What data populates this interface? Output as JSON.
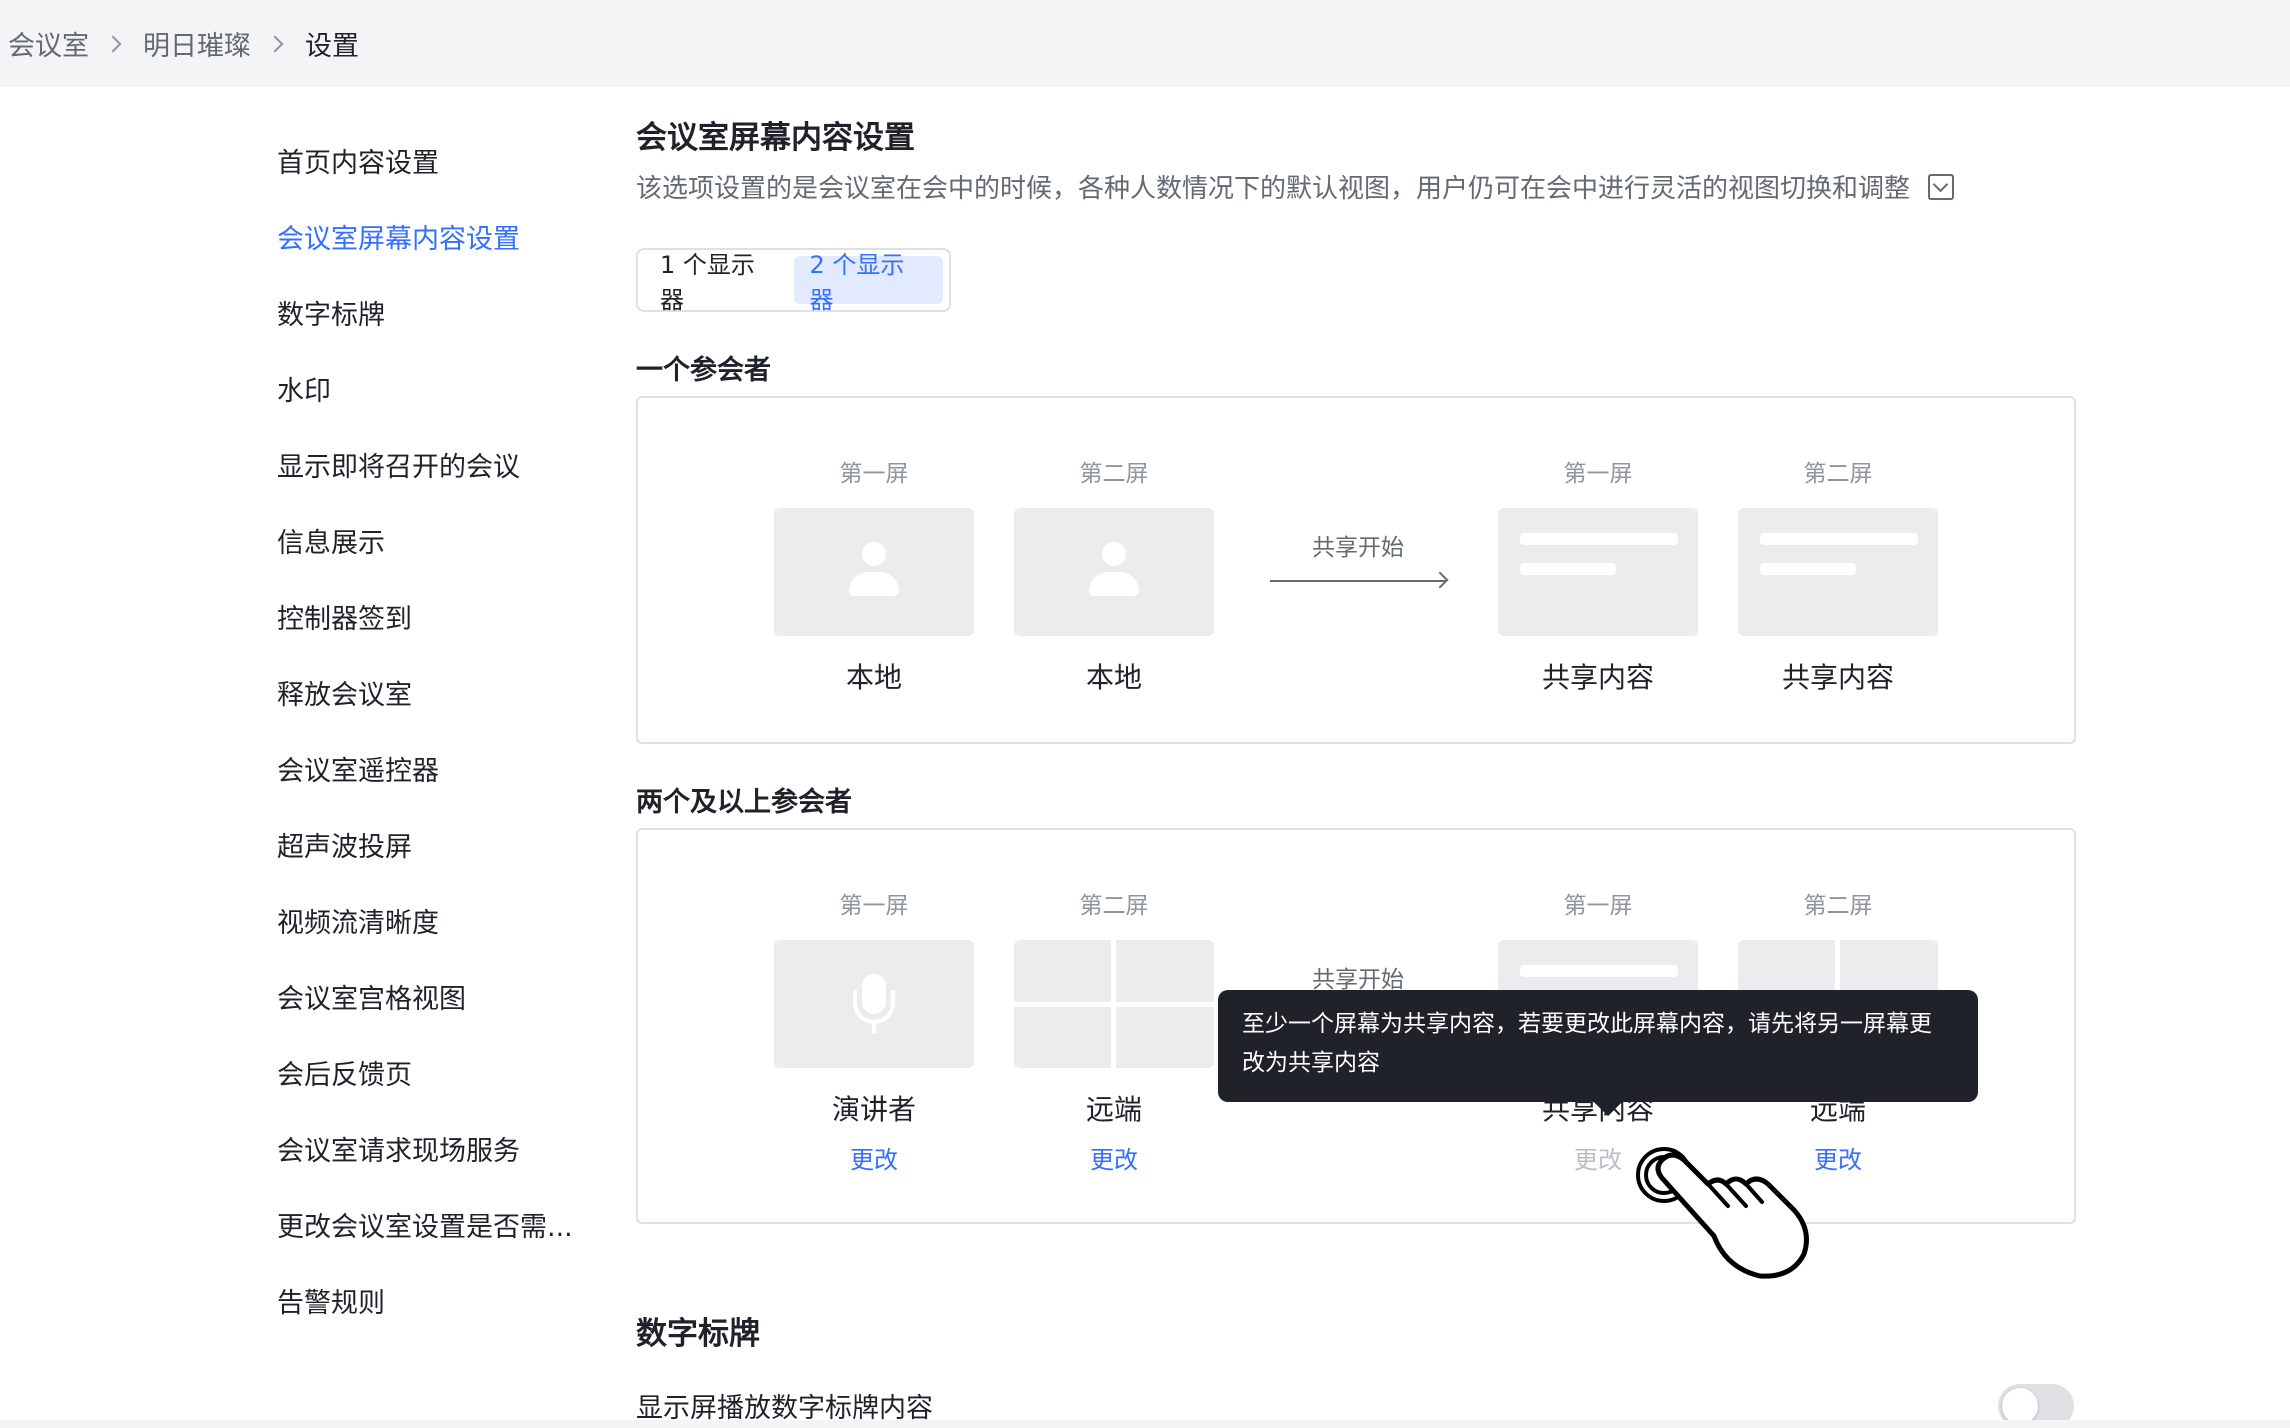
{
  "breadcrumb": [
    "会议室",
    "明日璀璨",
    "设置"
  ],
  "sidebar": {
    "items": [
      {
        "label": "首页内容设置",
        "active": false
      },
      {
        "label": "会议室屏幕内容设置",
        "active": true
      },
      {
        "label": "数字标牌",
        "active": false
      },
      {
        "label": "水印",
        "active": false
      },
      {
        "label": "显示即将召开的会议",
        "active": false
      },
      {
        "label": "信息展示",
        "active": false
      },
      {
        "label": "控制器签到",
        "active": false
      },
      {
        "label": "释放会议室",
        "active": false
      },
      {
        "label": "会议室遥控器",
        "active": false
      },
      {
        "label": "超声波投屏",
        "active": false
      },
      {
        "label": "视频流清晰度",
        "active": false
      },
      {
        "label": "会议室宫格视图",
        "active": false
      },
      {
        "label": "会后反馈页",
        "active": false
      },
      {
        "label": "会议室请求现场服务",
        "active": false
      },
      {
        "label": "更改会议室设置是否需...",
        "active": false
      },
      {
        "label": "告警规则",
        "active": false
      }
    ]
  },
  "main": {
    "title": "会议室屏幕内容设置",
    "description": "该选项设置的是会议室在会中的时候，各种人数情况下的默认视图，用户仍可在会中进行灵活的视图切换和调整",
    "display_tabs": [
      {
        "label": "1 个显示器",
        "active": false
      },
      {
        "label": "2 个显示器",
        "active": true
      }
    ],
    "one_participant": {
      "title": "一个参会者",
      "arrow_label": "共享开始",
      "screens": [
        {
          "head": "第一屏",
          "name": "本地",
          "icon": "person-icon"
        },
        {
          "head": "第二屏",
          "name": "本地",
          "icon": "person-icon"
        },
        {
          "head": "第一屏",
          "name": "共享内容",
          "icon": "shared-content-icon"
        },
        {
          "head": "第二屏",
          "name": "共享内容",
          "icon": "shared-content-icon"
        }
      ]
    },
    "multi_participants": {
      "title": "两个及以上参会者",
      "arrow_label": "共享开始",
      "screens": [
        {
          "head": "第一屏",
          "name": "演讲者",
          "icon": "microphone-icon",
          "link": "更改",
          "link_disabled": false
        },
        {
          "head": "第二屏",
          "name": "远端",
          "icon": "grid-view-icon",
          "link": "更改",
          "link_disabled": false
        },
        {
          "head": "第一屏",
          "name": "共享内容",
          "icon": "shared-content-icon",
          "link": "更改",
          "link_disabled": true
        },
        {
          "head": "第二屏",
          "name": "远端",
          "icon": "grid-view-icon",
          "link": "更改",
          "link_disabled": false
        }
      ]
    },
    "tooltip": "至少一个屏幕为共享内容，若要更改此屏幕内容，请先将另一屏幕更改为共享内容",
    "digital_signage": {
      "title": "数字标牌",
      "row_label": "显示屏播放数字标牌内容",
      "toggle_on": false
    }
  },
  "colors": {
    "accent": "#3370ff",
    "text": "#1f2329",
    "muted": "#646a73",
    "thumb": "#ebecee",
    "tooltip_bg": "#1f2329"
  }
}
